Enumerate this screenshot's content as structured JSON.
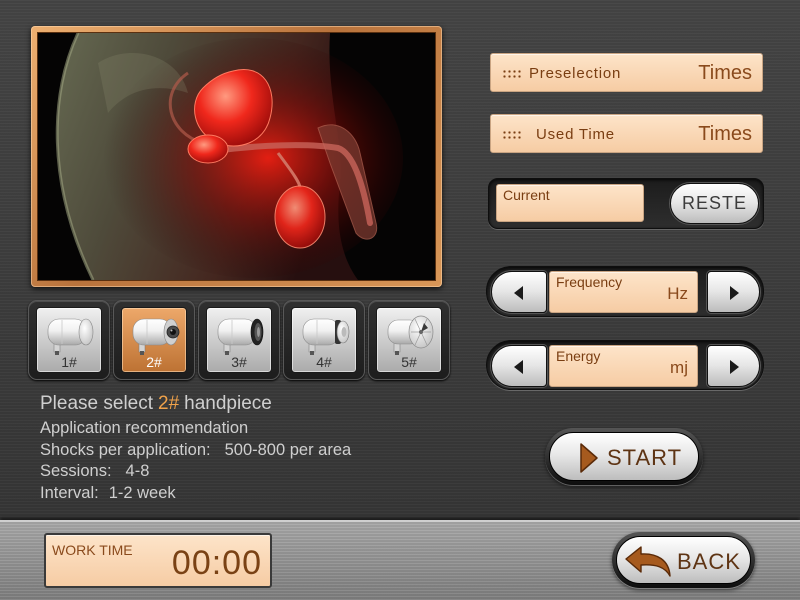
{
  "theme": {
    "peach_top": "#fde4c9",
    "peach_bottom": "#f6cca4",
    "label_brown": "#7a3e12",
    "unit_brown": "#8a4a1c",
    "selected_accent": "#f0a24a",
    "info_text": "#cfcfcf"
  },
  "hero": {
    "icon": "anatomy-illustration"
  },
  "handpieces": [
    {
      "label": "1#",
      "selected": false,
      "icon": "handpiece-icon"
    },
    {
      "label": "2#",
      "selected": true,
      "icon": "handpiece-icon"
    },
    {
      "label": "3#",
      "selected": false,
      "icon": "handpiece-icon"
    },
    {
      "label": "4#",
      "selected": false,
      "icon": "handpiece-icon"
    },
    {
      "label": "5#",
      "selected": false,
      "icon": "handpiece-icon"
    }
  ],
  "info": {
    "select_prefix": "Please select",
    "selected_handpiece": "2#",
    "select_suffix": "handpiece",
    "recommendation": "Application recommendation",
    "shocks_label": "Shocks per application:",
    "shocks_value": "500-800 per area",
    "sessions_label": "Sessions:",
    "sessions_value": "4-8",
    "interval_label": "Interval:",
    "interval_value": "1-2 week"
  },
  "counters": {
    "preselection": {
      "label": "Preselection",
      "unit": "Times",
      "icon": "grip-dots-icon"
    },
    "used_time": {
      "label": "Used Time",
      "unit": "Times",
      "icon": "grip-dots-icon"
    }
  },
  "current": {
    "label": "Current",
    "reset_label": "RESTE"
  },
  "frequency": {
    "label": "Frequency",
    "unit": "Hz",
    "decrease_icon": "arrow-left-icon",
    "increase_icon": "arrow-right-icon"
  },
  "energy": {
    "label": "Energy",
    "unit": "mj",
    "decrease_icon": "arrow-left-icon",
    "increase_icon": "arrow-right-icon"
  },
  "start": {
    "label": "START",
    "icon": "play-icon"
  },
  "footer": {
    "work_time_label": "WORK TIME",
    "work_time_value": "00:00",
    "back_label": "BACK",
    "back_icon": "back-arrow-icon"
  }
}
